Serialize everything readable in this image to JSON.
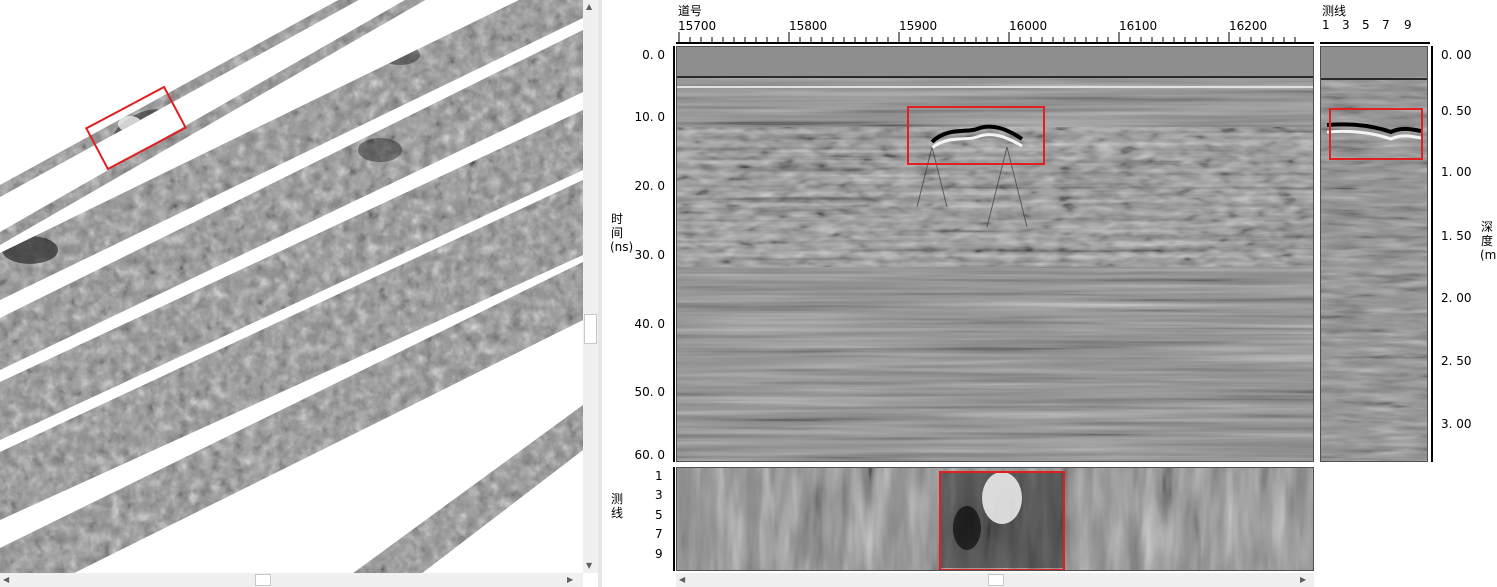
{
  "map_panel": {
    "strips": 9
  },
  "header": {
    "trace_label": "道号",
    "line_label": "测线"
  },
  "trace_ticks": [
    "15700",
    "15800",
    "15900",
    "16000",
    "16100",
    "16200"
  ],
  "time_axis": {
    "label": "时 间(ns)",
    "ticks": [
      "0. 0",
      "10. 0",
      "20. 0",
      "30. 0",
      "40. 0",
      "50. 0",
      "60. 0"
    ]
  },
  "line_top_ticks": [
    "1",
    "3",
    "5",
    "7",
    "9"
  ],
  "depth_axis": {
    "label": "深 度(m)",
    "ticks": [
      "0. 00",
      "0. 50",
      "1. 00",
      "1. 50",
      "2. 00",
      "2. 50",
      "3. 00"
    ]
  },
  "bottom_axis": {
    "label": "测 线",
    "ticks": [
      "1",
      "3",
      "5",
      "7",
      "9"
    ]
  },
  "colors": {
    "highlight": "#e02020",
    "panel_border": "#505050",
    "scrollbar": "#f0f0f0"
  }
}
